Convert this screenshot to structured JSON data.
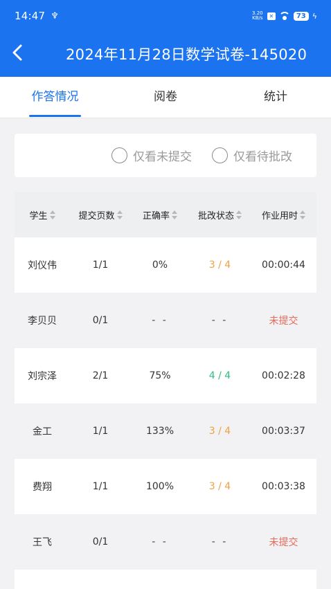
{
  "status_bar": {
    "time": "14:47",
    "usb_glyph": "♆",
    "net_speed_top": "3.20",
    "net_speed_bottom": "KB/s",
    "battery": "73",
    "icons": [
      "usb-icon",
      "sim-box-icon",
      "wifi-icon",
      "battery-icon",
      "charging-icon"
    ]
  },
  "app_bar": {
    "back_icon": "chevron-left-icon",
    "title": "2024年11月28日数学试卷-145020"
  },
  "tabs": [
    {
      "label": "作答情况",
      "active": true
    },
    {
      "label": "阅卷",
      "active": false
    },
    {
      "label": "统计",
      "active": false
    }
  ],
  "filters": [
    {
      "label": "仅看未提交",
      "checked": false
    },
    {
      "label": "仅看待批改",
      "checked": false
    }
  ],
  "table": {
    "columns": [
      "学生",
      "提交页数",
      "正确率",
      "批改状态",
      "作业用时"
    ],
    "rows": [
      {
        "student": "刘仪伟",
        "pages": "1/1",
        "accuracy": "0%",
        "grading": "3 / 4",
        "grading_color": "orange",
        "time": "00:00:44"
      },
      {
        "student": "李贝贝",
        "pages": "0/1",
        "accuracy": "- -",
        "grading": "- -",
        "grading_color": "none",
        "time": "未提交"
      },
      {
        "student": "刘宗泽",
        "pages": "2/1",
        "accuracy": "75%",
        "grading": "4 / 4",
        "grading_color": "green",
        "time": "00:02:28"
      },
      {
        "student": "金工",
        "pages": "1/1",
        "accuracy": "133%",
        "grading": "3 / 4",
        "grading_color": "orange",
        "time": "00:03:37"
      },
      {
        "student": "费翔",
        "pages": "1/1",
        "accuracy": "100%",
        "grading": "3 / 4",
        "grading_color": "orange",
        "time": "00:03:38"
      },
      {
        "student": "王飞",
        "pages": "0/1",
        "accuracy": "- -",
        "grading": "- -",
        "grading_color": "none",
        "time": "未提交"
      }
    ]
  },
  "colors": {
    "primary": "#1b73f0",
    "orange": "#f0a040",
    "green": "#2cbf82",
    "not_submitted": "#e86a5a"
  }
}
